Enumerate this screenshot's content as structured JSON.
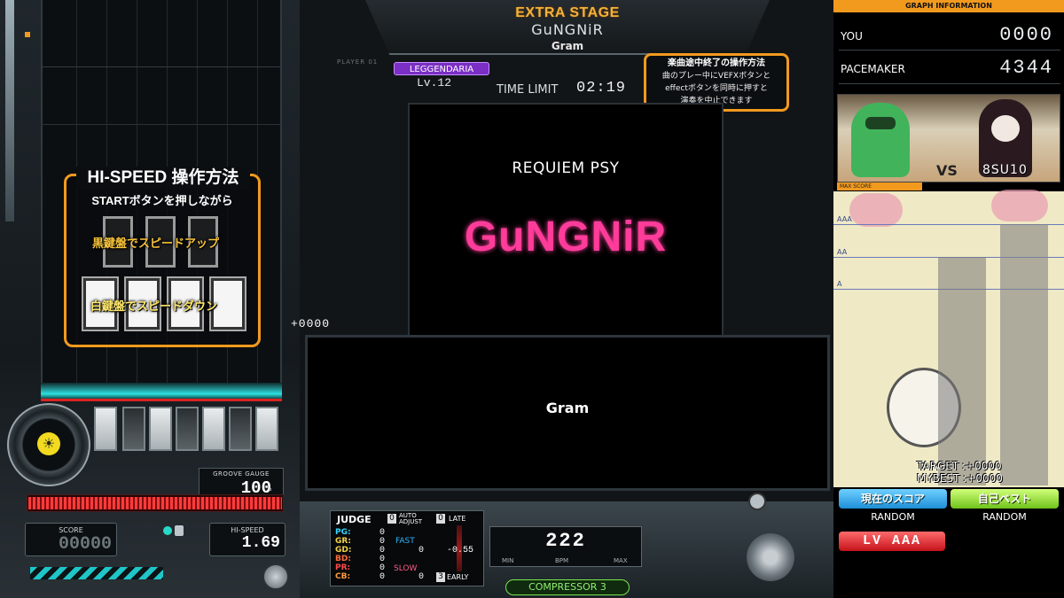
{
  "header": {
    "stage": "EXTRA STAGE",
    "song_title": "GuNGNiR",
    "artist": "Gram",
    "player_tag": "PLAYER 01",
    "difficulty": "LEGGENDARIA",
    "level": "Lv.12",
    "time_limit_label": "TIME LIMIT",
    "time_limit_value": "02:19"
  },
  "operation_help": {
    "title": "楽曲途中終了の操作方法",
    "line1": "曲のプレー中にVEFXボタンと",
    "line2": "effectボタンを同時に押すと",
    "line3": "演奏を中止できます"
  },
  "hispeed_help": {
    "title": "HI-SPEED 操作方法",
    "subtitle": "STARTボタンを押しながら",
    "black_keys_caption": "黒鍵盤でスピードアップ",
    "white_keys_caption": "白鍵盤でスピードダウン"
  },
  "jacket": {
    "top_text": "REQUIEM PSY",
    "logo": "GuNGNiR"
  },
  "combo": "+0000",
  "bga_text": "Gram",
  "gauge": {
    "label": "GROOVE GAUGE",
    "value": "100",
    "unit": "%",
    "fill_fraction": 1.0
  },
  "score": {
    "label": "SCORE",
    "value": "00000"
  },
  "hi_speed": {
    "label": "HI-SPEED",
    "value": "1.69"
  },
  "judge": {
    "title": "JUDGE",
    "auto_adjust_num": "0",
    "auto_adjust_label": "AUTO ADJUST",
    "late_num": "0",
    "late_label": "LATE",
    "early_num": "3",
    "early_label": "EARLY",
    "rows": [
      {
        "label": "PG:",
        "value": "0",
        "color": "#35d6ff"
      },
      {
        "label": "GR:",
        "value": "0",
        "color": "#f4d44a"
      },
      {
        "label": "GD:",
        "value": "0",
        "color": "#f4d44a"
      },
      {
        "label": "BD:",
        "value": "0",
        "color": "#ff6a3d"
      },
      {
        "label": "PR:",
        "value": "0",
        "color": "#ff4a4a"
      },
      {
        "label": "CB:",
        "value": "0",
        "color": "#ff9a3d"
      }
    ],
    "fast_label": "FAST",
    "fast_value": "0",
    "slow_label": "SLOW",
    "slow_value": "0",
    "offset": "-0.55"
  },
  "bpm": {
    "value": "222",
    "min_label": "MIN",
    "label": "BPM",
    "max_label": "MAX"
  },
  "compressor": "COMPRESSOR 3",
  "graph": {
    "title": "GRAPH INFORMATION",
    "you_label": "YOU",
    "you_value": "0000",
    "pacemaker_label": "PACEMAKER",
    "pacemaker_value": "4344",
    "vs": "VS",
    "rival_name": "8SU10",
    "max_score_label": "MAX SCORE",
    "grade_labels": [
      "AAA",
      "AA",
      "A"
    ],
    "target": "TARGET :+0000",
    "mybest": "MYBEST :+0000",
    "you_bar_fraction": 0.0,
    "pacemaker_bar_fraction": 0.88
  },
  "buttons": {
    "current_score": "現在のスコア",
    "personal_best": "自己ベスト",
    "random_left": "RANDOM",
    "random_right": "RANDOM",
    "level_grade": "LV AAA"
  },
  "colors": {
    "accent_orange": "#f29a1e",
    "gauge_red": "#ff3b3b",
    "leggendaria_purple": "#7b2fc4",
    "logo_pink": "#ff3c9a"
  }
}
